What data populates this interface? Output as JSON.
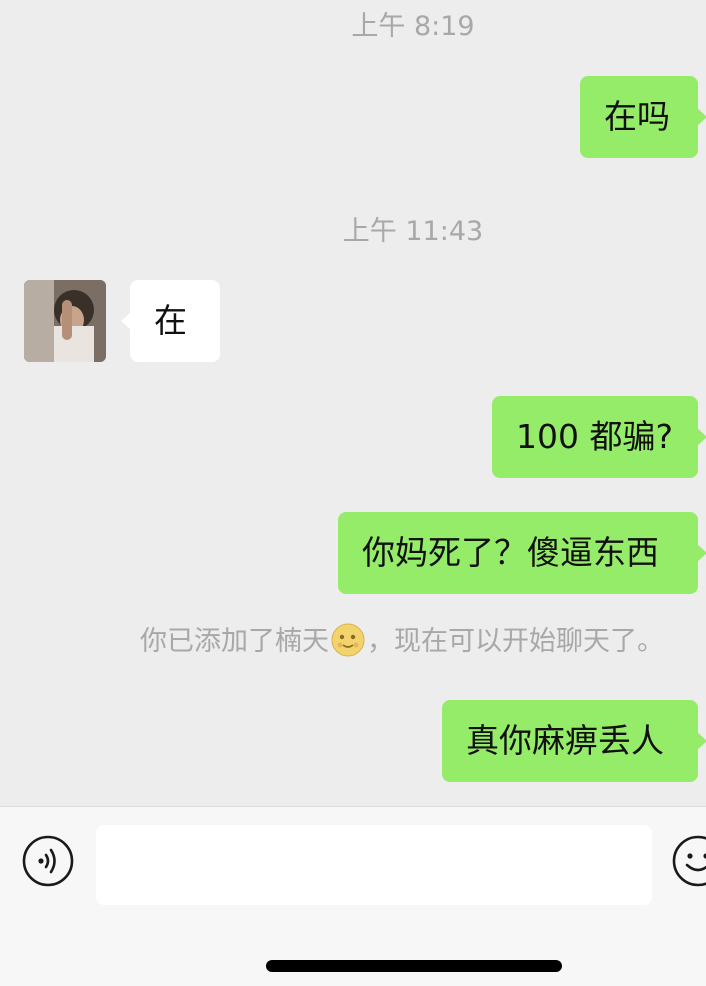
{
  "timestamps": [
    "上午 8:19",
    "上午 11:43"
  ],
  "messages": [
    {
      "direction": "out",
      "text": "在吗"
    },
    {
      "direction": "in",
      "text": "在"
    },
    {
      "direction": "out",
      "text": "100 都骗?"
    },
    {
      "direction": "out",
      "text": "你妈死了？傻逼东西"
    },
    {
      "direction": "out",
      "text": "真你麻痹丢人"
    }
  ],
  "system_note": {
    "before": "你已添加了楠天",
    "emoji": "smiling-moon-face",
    "after": "，现在可以开始聊天了。"
  },
  "input": {
    "value": "",
    "placeholder": ""
  },
  "icons": {
    "voice": "voice-input-icon",
    "emoji": "emoji-icon"
  },
  "colors": {
    "background": "#ededed",
    "outgoing_bubble": "#95ec69",
    "incoming_bubble": "#ffffff",
    "timestamp_text": "#a8a8a8",
    "input_bar": "#f7f7f7"
  }
}
